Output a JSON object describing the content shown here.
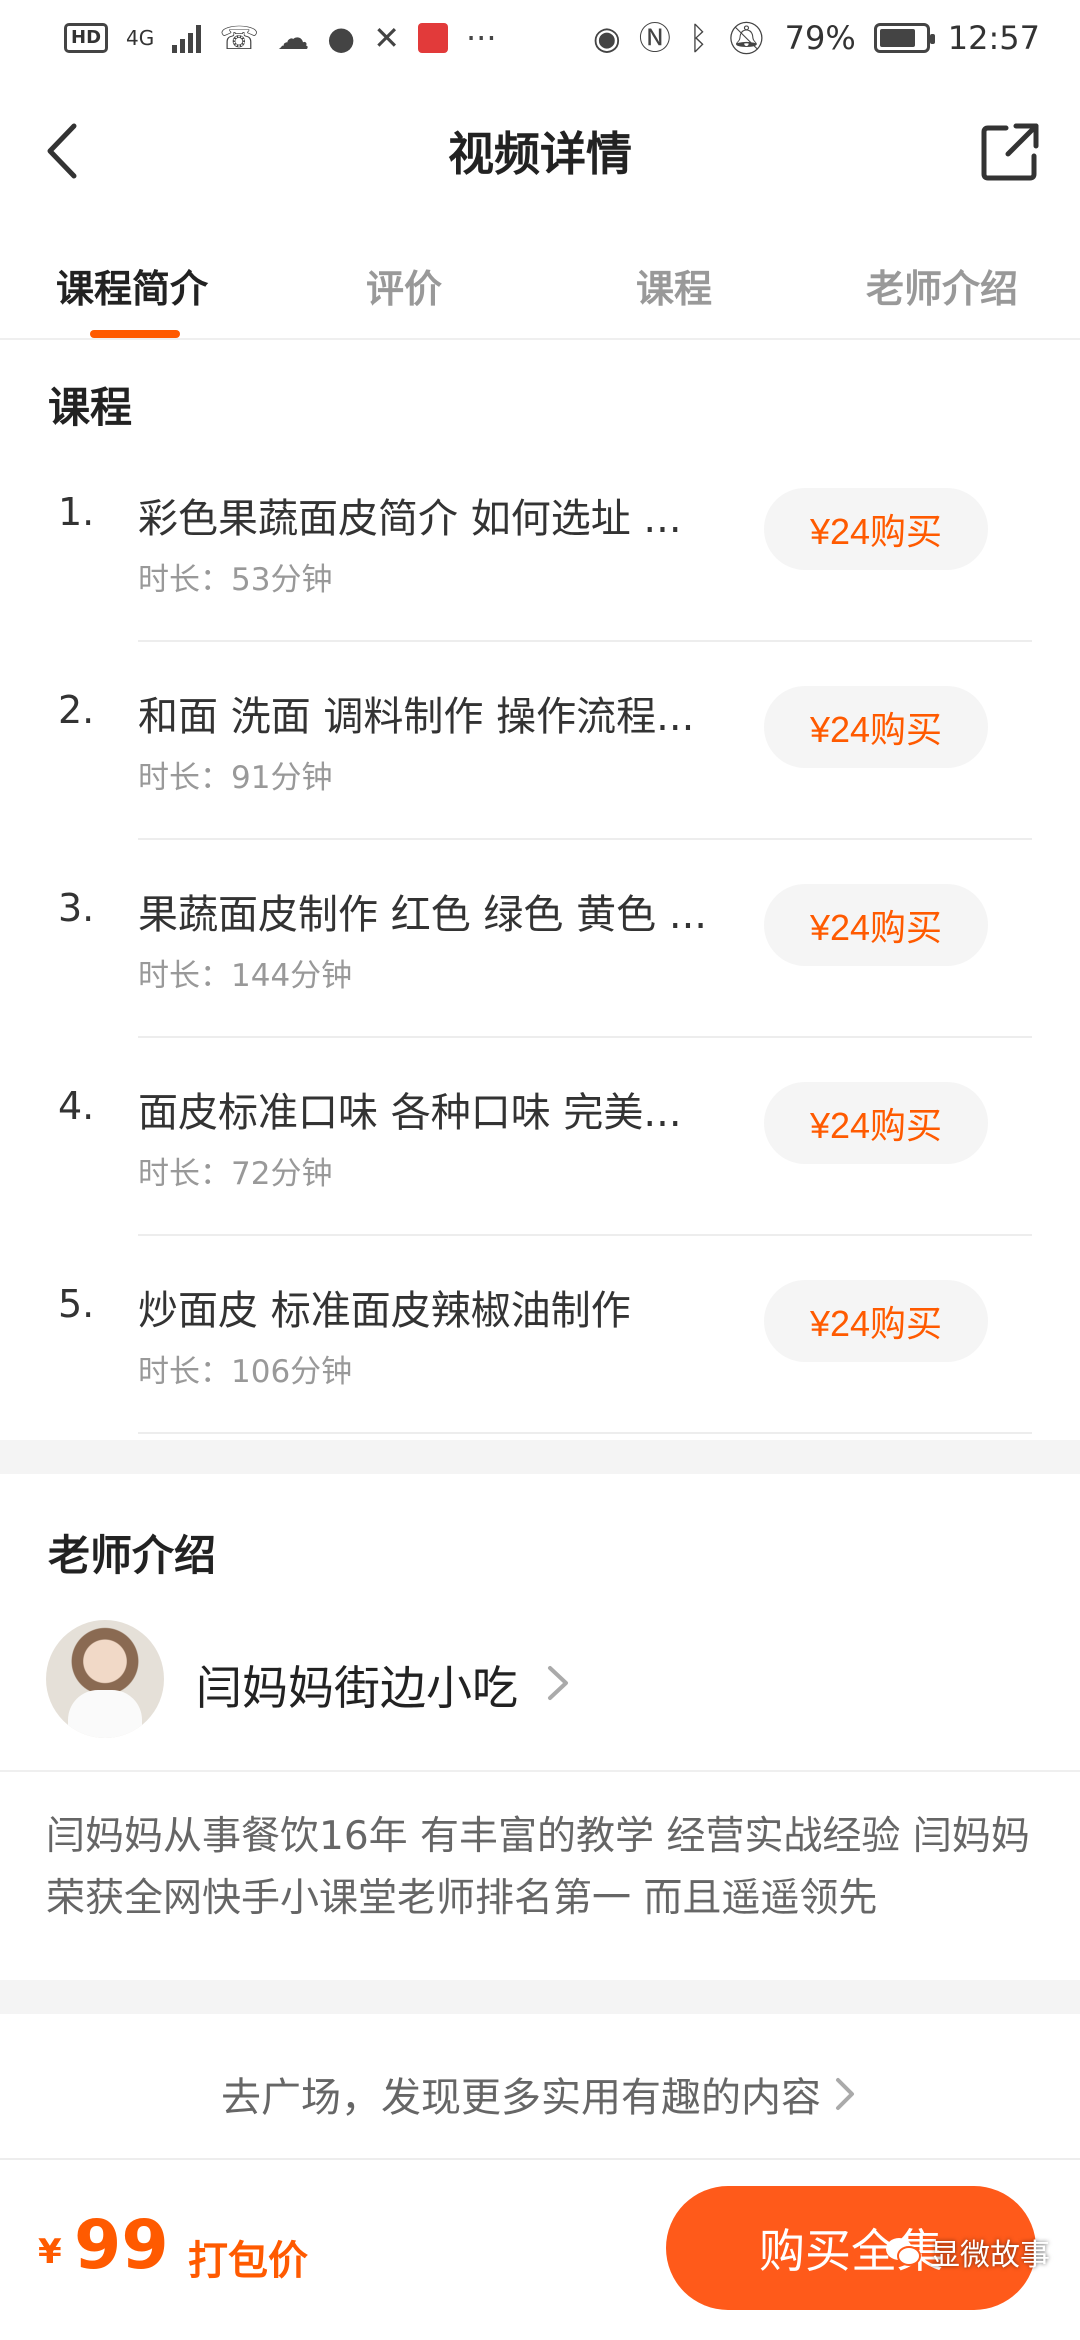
{
  "status_bar": {
    "hd": "HD",
    "network": "4G",
    "battery_percent": "79%",
    "battery_level": 0.79,
    "time": "12:57",
    "icons_left": [
      "missed-call-icon",
      "weather-icon",
      "message-icon",
      "alipay-icon",
      "book-app-icon",
      "more-icon"
    ],
    "icons_right": [
      "eye-icon",
      "nfc-icon",
      "bluetooth-icon",
      "mute-bell-icon",
      "battery-icon"
    ]
  },
  "header": {
    "title": "视频详情",
    "back_icon": "chevron-left-icon",
    "share_icon": "share-external-icon"
  },
  "tabs": [
    {
      "label": "课程简介",
      "active": true
    },
    {
      "label": "评价",
      "active": false
    },
    {
      "label": "课程",
      "active": false
    },
    {
      "label": "老师介绍",
      "active": false
    }
  ],
  "courses": {
    "title": "课程",
    "items": [
      {
        "num": "1.",
        "name": "彩色果蔬面皮简介 如何选址 ...",
        "duration": "时长：53分钟",
        "buy_label": "¥24购买"
      },
      {
        "num": "2.",
        "name": "和面 洗面 调料制作 操作流程...",
        "duration": "时长：91分钟",
        "buy_label": "¥24购买"
      },
      {
        "num": "3.",
        "name": "果蔬面皮制作 红色 绿色 黄色 ...",
        "duration": "时长：144分钟",
        "buy_label": "¥24购买"
      },
      {
        "num": "4.",
        "name": "面皮标准口味 各种口味 完美...",
        "duration": "时长：72分钟",
        "buy_label": "¥24购买"
      },
      {
        "num": "5.",
        "name": "炒面皮 标准面皮辣椒油制作",
        "duration": "时长：106分钟",
        "buy_label": "¥24购买"
      }
    ]
  },
  "teacher": {
    "title": "老师介绍",
    "name": "闫妈妈街边小吃",
    "description": "闫妈妈从事餐饮16年 有丰富的教学 经营实战经验 闫妈妈荣获全网快手小课堂老师排名第一 而且遥遥领先"
  },
  "discover": {
    "label": "去广场，发现更多实用有趣的内容"
  },
  "bottom_bar": {
    "price_symbol": "¥",
    "price": "99",
    "price_tag": "打包价",
    "buy_all_label": "购买全集"
  },
  "watermark": {
    "text": "显微故事"
  },
  "colors": {
    "accent": "#ff5a00",
    "buy_all_bg": "#ff5a1a",
    "text_primary": "#222222",
    "text_secondary": "#999999",
    "chip_bg": "#f5f5f5"
  }
}
